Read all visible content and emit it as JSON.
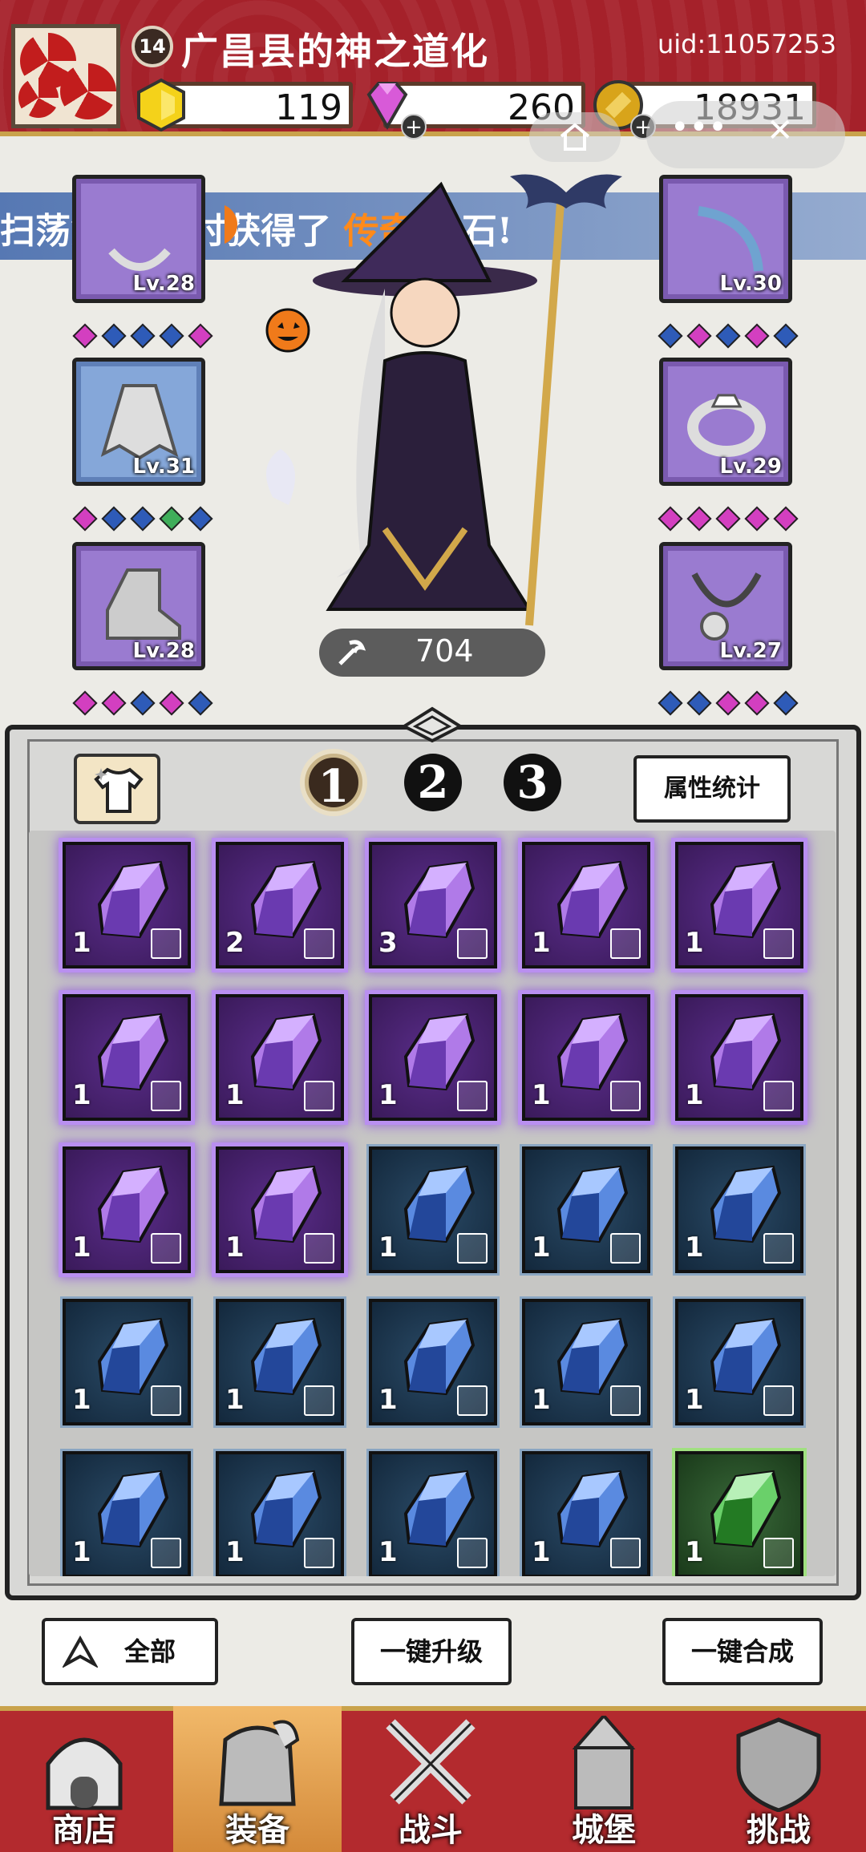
{
  "player": {
    "name": "广昌县的神之道化",
    "level": "14",
    "uid": "uid:11057253"
  },
  "resources": [
    {
      "name": "gold-hex",
      "value": "119",
      "color": "#f4d21a"
    },
    {
      "name": "diamond",
      "value": "260",
      "color": "#d85ad8"
    },
    {
      "name": "coin",
      "value": "18931",
      "color": "#d8a41a"
    }
  ],
  "banner": {
    "prefix": "扫荡第10关时获得了",
    "highlight": "传奇",
    "suffix": "宝石!"
  },
  "equipment": {
    "left": [
      {
        "slot": "necklace-top",
        "level": "Lv.28"
      },
      {
        "slot": "cloak",
        "level": "Lv.31"
      },
      {
        "slot": "boots",
        "level": "Lv.28"
      }
    ],
    "right": [
      {
        "slot": "bow",
        "level": "Lv.30"
      },
      {
        "slot": "ring",
        "level": "Lv.29"
      },
      {
        "slot": "necklace",
        "level": "Lv.27"
      }
    ]
  },
  "power": "704",
  "tabs": {
    "pages": [
      "1",
      "2",
      "3"
    ],
    "active_page": "1",
    "stats_label": "属性统计"
  },
  "gems": [
    {
      "color": "purple",
      "count": "1",
      "slot": "cloak"
    },
    {
      "color": "purple",
      "count": "2",
      "slot": "cloak"
    },
    {
      "color": "purple",
      "count": "3",
      "slot": "cape"
    },
    {
      "color": "purple",
      "count": "1",
      "slot": "boot"
    },
    {
      "color": "purple",
      "count": "1",
      "slot": "boot"
    },
    {
      "color": "purple",
      "count": "1",
      "slot": "boot"
    },
    {
      "color": "purple",
      "count": "1",
      "slot": "staff"
    },
    {
      "color": "purple",
      "count": "1",
      "slot": "staff"
    },
    {
      "color": "purple",
      "count": "1",
      "slot": "staff"
    },
    {
      "color": "purple",
      "count": "1",
      "slot": "ring"
    },
    {
      "color": "purple",
      "count": "1",
      "slot": "necklace"
    },
    {
      "color": "purple",
      "count": "1",
      "slot": "necklace"
    },
    {
      "color": "blue",
      "count": "1",
      "slot": "cloak"
    },
    {
      "color": "blue",
      "count": "1",
      "slot": "cloak"
    },
    {
      "color": "blue",
      "count": "1",
      "slot": "cloak"
    },
    {
      "color": "blue",
      "count": "1",
      "slot": "boot"
    },
    {
      "color": "blue",
      "count": "1",
      "slot": "boot"
    },
    {
      "color": "blue",
      "count": "1",
      "slot": "staff"
    },
    {
      "color": "blue",
      "count": "1",
      "slot": "staff"
    },
    {
      "color": "blue",
      "count": "1",
      "slot": "staff"
    },
    {
      "color": "blue",
      "count": "1",
      "slot": "necklace"
    },
    {
      "color": "blue",
      "count": "1",
      "slot": "necklace"
    },
    {
      "color": "blue",
      "count": "1",
      "slot": "necklace"
    },
    {
      "color": "blue",
      "count": "1",
      "slot": "necklace"
    },
    {
      "color": "green",
      "count": "1",
      "slot": "cape"
    }
  ],
  "actions": {
    "filter_label": "全部",
    "upgrade_label": "一键升级",
    "merge_label": "一键合成"
  },
  "nav": [
    {
      "label": "商店",
      "icon": "shop-icon"
    },
    {
      "label": "装备",
      "icon": "bag-icon"
    },
    {
      "label": "战斗",
      "icon": "swords-icon"
    },
    {
      "label": "城堡",
      "icon": "castle-icon"
    },
    {
      "label": "挑战",
      "icon": "shield-icon"
    }
  ],
  "active_nav": "装备"
}
